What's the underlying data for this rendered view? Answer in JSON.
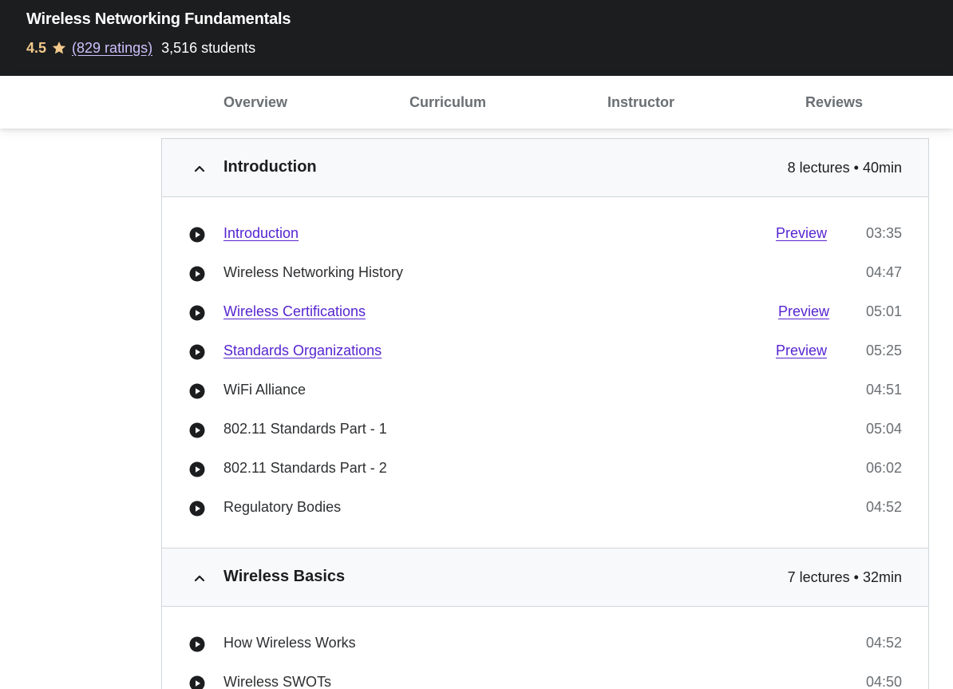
{
  "header": {
    "title": "Wireless Networking Fundamentals",
    "rating": "4.5",
    "ratings_count": "(829 ratings)",
    "students": "3,516 students"
  },
  "tabs": [
    {
      "label": "Overview"
    },
    {
      "label": "Curriculum"
    },
    {
      "label": "Instructor"
    },
    {
      "label": "Reviews"
    }
  ],
  "colors": {
    "top_bar": "#1c1d1f",
    "rating": "#f3ca8c",
    "link": "#5624d0"
  },
  "sections": [
    {
      "title": "Introduction",
      "meta": "8 lectures • 40min",
      "lectures": [
        {
          "title": "Introduction",
          "preview": "Preview",
          "duration": "03:35"
        },
        {
          "title": "Wireless Networking History",
          "duration": "04:47"
        },
        {
          "title": "Wireless Certifications",
          "preview": "Preview",
          "duration": "05:01"
        },
        {
          "title": "Standards Organizations",
          "preview": "Preview",
          "duration": "05:25"
        },
        {
          "title": "WiFi Alliance",
          "duration": "04:51"
        },
        {
          "title": "802.11 Standards Part - 1",
          "duration": "05:04"
        },
        {
          "title": "802.11 Standards Part - 2",
          "duration": "06:02"
        },
        {
          "title": "Regulatory Bodies",
          "duration": "04:52"
        }
      ]
    },
    {
      "title": "Wireless Basics",
      "meta": "7 lectures • 32min",
      "lectures": [
        {
          "title": "How Wireless Works",
          "duration": "04:52"
        },
        {
          "title": "Wireless SWOTs",
          "duration": "04:50"
        }
      ]
    }
  ]
}
